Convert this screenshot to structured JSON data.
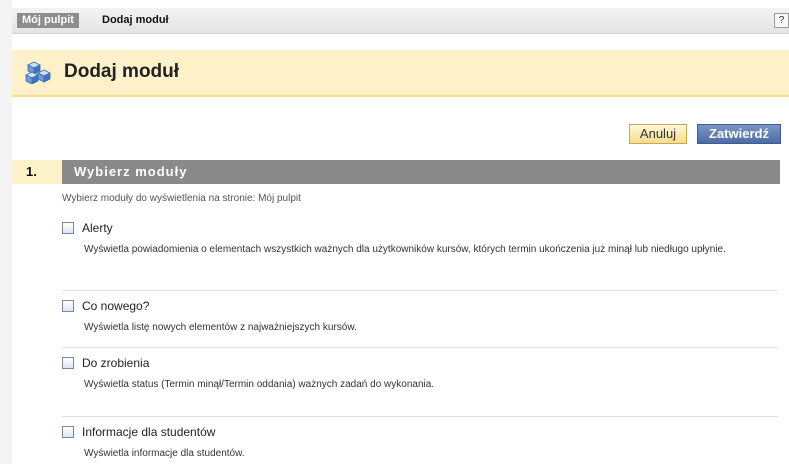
{
  "breadcrumb": {
    "home": "Mój pulpit",
    "current": "Dodaj moduł",
    "help": "?"
  },
  "page": {
    "title": "Dodaj moduł",
    "icon": "cubes-icon"
  },
  "actions": {
    "cancel": "Anuluj",
    "submit": "Zatwierdź"
  },
  "section": {
    "number": "1.",
    "title": "Wybierz moduły",
    "instruction": "Wybierz moduły do wyświetlenia na stronie: Mój pulpit"
  },
  "modules": [
    {
      "name": "Alerty",
      "description": "Wyświetla powiadomienia o elementach wszystkich ważnych dla użytkowników kursów, których termin ukończenia już minął lub niedługo upłynie.",
      "checked": false
    },
    {
      "name": "Co nowego?",
      "description": "Wyświetla listę nowych elementów z najważniejszych kursów.",
      "checked": false
    },
    {
      "name": "Do zrobienia",
      "description": "Wyświetla status (Termin minął/Termin oddania) ważnych zadań do wykonania.",
      "checked": false
    },
    {
      "name": "Informacje dla studentów",
      "description": "Wyświetla informacje dla studentów.",
      "checked": false
    }
  ]
}
